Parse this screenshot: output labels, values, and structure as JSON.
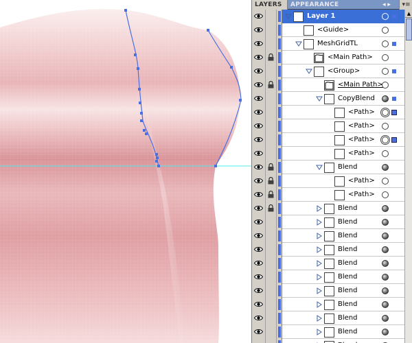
{
  "panel": {
    "tabs": [
      {
        "label": "LAYERS",
        "active": true
      },
      {
        "label": "APPEARANCE",
        "active": false
      }
    ],
    "tab_arrows": "◂ ▸",
    "menu_icon": "▾≡"
  },
  "colors": {
    "selection": "#3a6fd8",
    "layer_color": "#4a6fe0",
    "guide_line": "#4ee8e8",
    "path_stroke": "#4a6fe0",
    "mesh_light": "#f7e6e6",
    "mesh_dark": "#d88a8e"
  },
  "layers": [
    {
      "name": "Layer 1",
      "indent": 0,
      "tri": "open",
      "thumb": "box",
      "lock": false,
      "target": "open",
      "sel": "square",
      "selected": true
    },
    {
      "name": "<Guide>",
      "indent": 1,
      "tri": "none",
      "thumb": "box",
      "lock": false,
      "target": "open",
      "sel": "none"
    },
    {
      "name": "MeshGridTL",
      "indent": 1,
      "tri": "open",
      "thumb": "box",
      "lock": false,
      "target": "open",
      "sel": "square"
    },
    {
      "name": "<Main Path>",
      "indent": 2,
      "tri": "none",
      "thumb": "path",
      "lock": true,
      "target": "open",
      "sel": "none"
    },
    {
      "name": "<Group>",
      "indent": 2,
      "tri": "open",
      "thumb": "box",
      "lock": false,
      "target": "open",
      "sel": "square"
    },
    {
      "name": "<Main Path>",
      "indent": 3,
      "tri": "none",
      "thumb": "path",
      "lock": true,
      "target": "open",
      "sel": "none",
      "underline": true
    },
    {
      "name": "CopyBlend",
      "indent": 3,
      "tri": "open",
      "thumb": "box",
      "lock": false,
      "target": "filled",
      "sel": "square"
    },
    {
      "name": "<Path>",
      "indent": 4,
      "tri": "none",
      "thumb": "box",
      "lock": false,
      "target": "double",
      "sel": "big"
    },
    {
      "name": "<Path>",
      "indent": 4,
      "tri": "none",
      "thumb": "box",
      "lock": false,
      "target": "open",
      "sel": "none"
    },
    {
      "name": "<Path>",
      "indent": 4,
      "tri": "none",
      "thumb": "box",
      "lock": false,
      "target": "double",
      "sel": "big"
    },
    {
      "name": "<Path>",
      "indent": 4,
      "tri": "none",
      "thumb": "box",
      "lock": false,
      "target": "open",
      "sel": "none"
    },
    {
      "name": "Blend",
      "indent": 3,
      "tri": "open",
      "thumb": "box",
      "lock": true,
      "target": "filled",
      "sel": "none"
    },
    {
      "name": "<Path>",
      "indent": 4,
      "tri": "none",
      "thumb": "box",
      "lock": true,
      "target": "open",
      "sel": "none"
    },
    {
      "name": "<Path>",
      "indent": 4,
      "tri": "none",
      "thumb": "box",
      "lock": true,
      "target": "open",
      "sel": "none"
    },
    {
      "name": "Blend",
      "indent": 3,
      "tri": "closed",
      "thumb": "box",
      "lock": true,
      "target": "filled",
      "sel": "none"
    },
    {
      "name": "Blend",
      "indent": 3,
      "tri": "closed",
      "thumb": "box",
      "lock": false,
      "target": "filled",
      "sel": "none"
    },
    {
      "name": "Blend",
      "indent": 3,
      "tri": "closed",
      "thumb": "box",
      "lock": false,
      "target": "filled",
      "sel": "none"
    },
    {
      "name": "Blend",
      "indent": 3,
      "tri": "closed",
      "thumb": "box",
      "lock": false,
      "target": "filled",
      "sel": "none"
    },
    {
      "name": "Blend",
      "indent": 3,
      "tri": "closed",
      "thumb": "box",
      "lock": false,
      "target": "filled",
      "sel": "none"
    },
    {
      "name": "Blend",
      "indent": 3,
      "tri": "closed",
      "thumb": "box",
      "lock": false,
      "target": "filled",
      "sel": "none"
    },
    {
      "name": "Blend",
      "indent": 3,
      "tri": "closed",
      "thumb": "box",
      "lock": false,
      "target": "filled",
      "sel": "none"
    },
    {
      "name": "Blend",
      "indent": 3,
      "tri": "closed",
      "thumb": "box",
      "lock": false,
      "target": "filled",
      "sel": "none"
    },
    {
      "name": "Blend",
      "indent": 3,
      "tri": "closed",
      "thumb": "box",
      "lock": false,
      "target": "filled",
      "sel": "none"
    },
    {
      "name": "Blend",
      "indent": 3,
      "tri": "closed",
      "thumb": "box",
      "lock": false,
      "target": "filled",
      "sel": "none"
    },
    {
      "name": "Blend",
      "indent": 3,
      "tri": "closed",
      "thumb": "box",
      "lock": false,
      "target": "filled",
      "sel": "none"
    }
  ]
}
